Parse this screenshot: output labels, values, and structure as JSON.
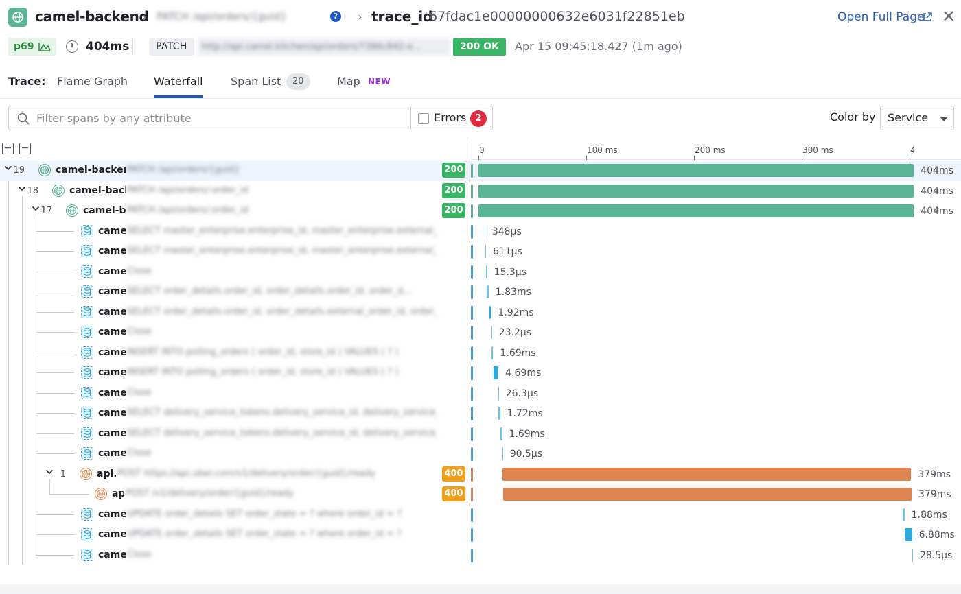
{
  "header": {
    "service": "camel-backend",
    "resource": "PATCH /api/orders/{guid}",
    "trace_label": "trace_id",
    "trace_id": "67fdac1e00000000632e6031f22851eb",
    "open_full_page": "Open Full Page",
    "percentile": "p69",
    "duration": "404ms",
    "method": "PATCH",
    "url": "http://api.camel.kitchen/api/orders/7386c842-e...",
    "status": "200 OK",
    "timestamp": "Apr 15 09:45:18.427 (1m ago)"
  },
  "tabs": {
    "label": "Trace:",
    "items": [
      {
        "label": "Flame Graph"
      },
      {
        "label": "Waterfall"
      },
      {
        "label": "Span List",
        "count": "20"
      },
      {
        "label": "Map",
        "badge": "NEW"
      }
    ],
    "active": "Waterfall"
  },
  "filter": {
    "placeholder": "Filter spans by any attribute",
    "errors_label": "Errors",
    "errors_count": "2",
    "color_by_label": "Color by",
    "color_by_value": "Service"
  },
  "axis": {
    "ticks": [
      "0",
      "100 ms",
      "200 ms",
      "300 ms",
      "400 ms"
    ],
    "max_ms": 404
  },
  "spans": [
    {
      "depth": 0,
      "count": "19",
      "kind": "web",
      "service": "camel-backend",
      "resource": "PATCH /api/orders/{guid}",
      "code": "200",
      "start_ms": 0,
      "dur_ms": 404,
      "label": "404ms",
      "color": "green",
      "expanded": true
    },
    {
      "depth": 1,
      "count": "18",
      "kind": "web",
      "service": "camel-backend",
      "resource": "PATCH /api/orders/:order_id",
      "code": "200",
      "start_ms": 0,
      "dur_ms": 404,
      "label": "404ms",
      "color": "green",
      "expanded": true
    },
    {
      "depth": 2,
      "count": "17",
      "kind": "web",
      "service": "camel-backend",
      "resource": "PATCH /api/orders/:order_id",
      "code": "200",
      "start_ms": 0,
      "dur_ms": 404,
      "label": "404ms",
      "color": "green",
      "expanded": true
    },
    {
      "depth": 3,
      "kind": "db",
      "service": "camel-db",
      "resource": "SELECT master_enterprise.enterprise_id, master_enterprise.external_en...",
      "start_ms": 5.5,
      "dur_ms": 0.348,
      "label": "348µs",
      "color": "blue"
    },
    {
      "depth": 3,
      "kind": "db",
      "service": "camel-db",
      "resource": "SELECT master_enterprise.enterprise_id, master_enterprise.external_en...",
      "start_ms": 6.2,
      "dur_ms": 0.611,
      "label": "611µs",
      "color": "blue"
    },
    {
      "depth": 3,
      "kind": "db",
      "service": "camel-db",
      "resource": "Close",
      "start_ms": 7.3,
      "dur_ms": 0.0153,
      "label": "15.3µs",
      "color": "blue"
    },
    {
      "depth": 3,
      "kind": "db",
      "service": "camel-db",
      "resource": "SELECT order_details.order_id, order_details.order_id, order_d...",
      "start_ms": 7.6,
      "dur_ms": 1.83,
      "label": "1.83ms",
      "color": "blue"
    },
    {
      "depth": 3,
      "kind": "db",
      "service": "camel-db",
      "resource": "SELECT order_details.order_id, order_details.external_order_id, order_d...",
      "start_ms": 9.8,
      "dur_ms": 1.92,
      "label": "1.92ms",
      "color": "blue"
    },
    {
      "depth": 3,
      "kind": "db",
      "service": "camel-db",
      "resource": "Close",
      "start_ms": 11.8,
      "dur_ms": 0.0232,
      "label": "23.2µs",
      "color": "blue"
    },
    {
      "depth": 3,
      "kind": "db",
      "service": "camel-db",
      "resource": "INSERT INTO polling_orders ( order_id, store_id ) VALUES ( ? )",
      "start_ms": 12.0,
      "dur_ms": 1.69,
      "label": "1.69ms",
      "color": "blue"
    },
    {
      "depth": 3,
      "kind": "db",
      "service": "camel-db",
      "resource": "INSERT INTO polling_orders ( order_id, store_id ) VALUES ( ? )",
      "start_ms": 13.9,
      "dur_ms": 4.69,
      "label": "4.69ms",
      "color": "blue"
    },
    {
      "depth": 3,
      "kind": "db",
      "service": "camel-db",
      "resource": "Close",
      "start_ms": 18.2,
      "dur_ms": 0.0263,
      "label": "26.3µs",
      "color": "blue"
    },
    {
      "depth": 3,
      "kind": "db",
      "service": "camel-db",
      "resource": "SELECT delivery_service_tokens.delivery_service_id, delivery_service_tok...",
      "start_ms": 18.4,
      "dur_ms": 1.72,
      "label": "1.72ms",
      "color": "blue"
    },
    {
      "depth": 3,
      "kind": "db",
      "service": "camel-db",
      "resource": "SELECT delivery_service_tokens.delivery_service_id, delivery_service_tok...",
      "start_ms": 20.3,
      "dur_ms": 1.69,
      "label": "1.69ms",
      "color": "blue"
    },
    {
      "depth": 3,
      "kind": "db",
      "service": "camel-db",
      "resource": "Close",
      "start_ms": 22.0,
      "dur_ms": 0.0905,
      "label": "90.5µs",
      "color": "blue"
    },
    {
      "depth": 3,
      "count": "1",
      "kind": "ext",
      "service": "api.ubereats",
      "resource": "POST https://api.uber.com/v1/delivery/order/{guid}/ready",
      "code": "400",
      "start_ms": 22.5,
      "dur_ms": 379,
      "label": "379ms",
      "color": "orange",
      "expanded": true
    },
    {
      "depth": 4,
      "kind": "ext",
      "service": "api.ubereats",
      "resource": "POST /v1/delivery/order/{guid}/ready",
      "code": "400",
      "start_ms": 22.9,
      "dur_ms": 379,
      "label": "379ms",
      "color": "orange"
    },
    {
      "depth": 3,
      "kind": "db",
      "service": "camel-db",
      "resource": "UPDATE order_details SET order_state = ? where order_id = ?",
      "start_ms": 393.5,
      "dur_ms": 1.88,
      "label": "1.88ms",
      "color": "blue"
    },
    {
      "depth": 3,
      "kind": "db",
      "service": "camel-db",
      "resource": "UPDATE order_details SET order_state = ? where order_id = ?",
      "start_ms": 395.4,
      "dur_ms": 6.88,
      "label": "6.88ms",
      "color": "blue"
    },
    {
      "depth": 3,
      "kind": "db",
      "service": "camel-db",
      "resource": "Close",
      "start_ms": 402.4,
      "dur_ms": 0.0285,
      "label": "28.5µs",
      "color": "blue"
    }
  ],
  "colors": {
    "green": "#5ab596",
    "orange": "#df8450",
    "blue": "#2fa8dc",
    "ok": "#39b665",
    "err": "#f0a01d",
    "link": "#2c5fb8",
    "accent": "#1e5bc6"
  }
}
